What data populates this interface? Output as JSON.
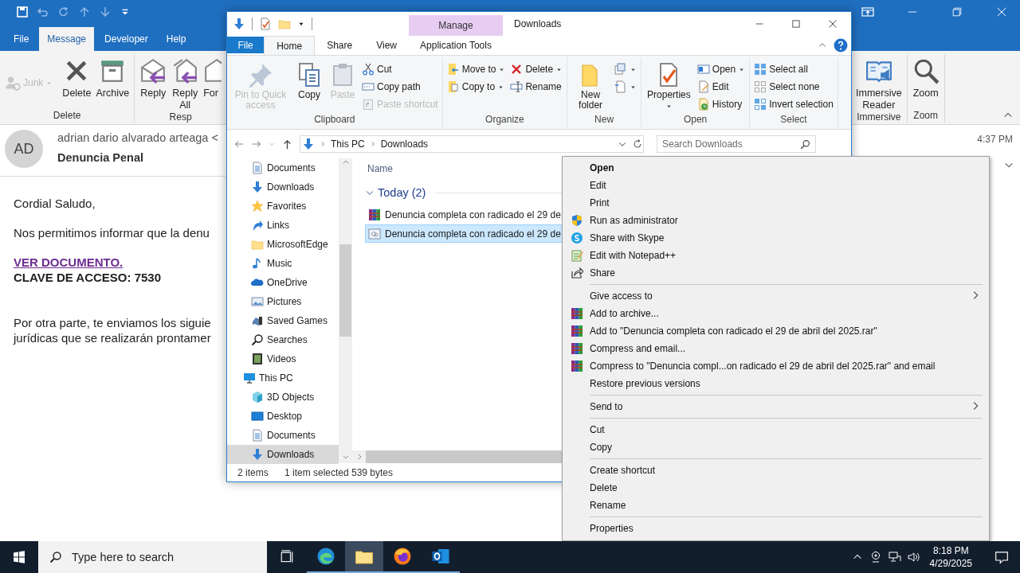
{
  "outlook": {
    "tabs": [
      {
        "label": "File",
        "selected": false
      },
      {
        "label": "Message",
        "selected": true
      },
      {
        "label": "Developer",
        "selected": false
      },
      {
        "label": "Help",
        "selected": false
      }
    ],
    "ribbon_left": [
      {
        "label": "Delete",
        "small": [
          {
            "kind": "junk",
            "label": "Junk",
            "disabled": true
          }
        ],
        "large": [
          {
            "kind": "delete-x",
            "label": "Delete"
          },
          {
            "kind": "archive-box",
            "label": "Archive"
          }
        ]
      },
      {
        "label": "Resp",
        "large": [
          {
            "kind": "reply",
            "label": "Reply"
          },
          {
            "kind": "reply-all",
            "label": "Reply All"
          },
          {
            "kind": "forward",
            "label": "For"
          }
        ]
      }
    ],
    "ribbon_right": [
      {
        "label": "Immersive",
        "large": [
          {
            "kind": "reader",
            "label": "Immersive Reader"
          }
        ]
      },
      {
        "label": "Zoom",
        "large": [
          {
            "kind": "zoom",
            "label": "Zoom"
          }
        ]
      }
    ],
    "message": {
      "avatar": "AD",
      "sender": "adrian dario alvarado arteaga <",
      "subject": "Denuncia Penal",
      "time": "4:37 PM",
      "paragraphs": [
        [
          {
            "kind": "text",
            "text": "Cordial Saludo,"
          }
        ],
        [
          {
            "kind": "text",
            "text": "Nos permitimos informar que la denu"
          }
        ],
        [
          {
            "kind": "link",
            "text": "VER DOCUMENTO."
          },
          {
            "kind": "strong",
            "text": "CLAVE DE ACCESO: 7530"
          }
        ],
        [
          {
            "kind": "text",
            "text": "Por otra parte, te enviamos los siguie"
          },
          {
            "kind": "text",
            "text": "jurídicas que se realizarán prontamer"
          }
        ]
      ]
    }
  },
  "explorer": {
    "context_tab": "Manage",
    "title": "Downloads",
    "tabs": [
      {
        "label": "File",
        "kind": "file",
        "selected": false
      },
      {
        "label": "Home",
        "kind": "tab",
        "selected": true
      },
      {
        "label": "Share",
        "kind": "tab",
        "selected": false
      },
      {
        "label": "View",
        "kind": "tab",
        "selected": false
      },
      {
        "label": "Application Tools",
        "kind": "context",
        "selected": false
      }
    ],
    "ribbon": [
      {
        "label": "Clipboard",
        "large": [
          {
            "kind": "pin",
            "label": "Pin to Quick access",
            "disabled": true
          },
          {
            "kind": "copy",
            "label": "Copy",
            "disabled": false
          },
          {
            "kind": "paste",
            "label": "Paste",
            "disabled": true
          }
        ],
        "columns": [
          [
            {
              "kind": "cut",
              "label": "Cut",
              "disabled": false
            },
            {
              "kind": "copy-path",
              "label": "Copy path",
              "disabled": false
            },
            {
              "kind": "paste-shortcut",
              "label": "Paste shortcut",
              "disabled": true
            }
          ]
        ]
      },
      {
        "label": "Organize",
        "columns": [
          [
            {
              "kind": "move-to",
              "label": "Move to",
              "dropdown": true
            },
            {
              "kind": "copy-to",
              "label": "Copy to",
              "dropdown": true
            }
          ],
          [
            {
              "kind": "delete-red",
              "label": "Delete",
              "dropdown": true
            },
            {
              "kind": "rename",
              "label": "Rename",
              "dropdown": false
            }
          ]
        ]
      },
      {
        "label": "New",
        "large": [
          {
            "kind": "new-folder",
            "label": "New folder"
          }
        ],
        "columns": [
          [
            {
              "kind": "new-item",
              "dropdown": true
            },
            {
              "kind": "easy-access",
              "dropdown": true
            }
          ]
        ]
      },
      {
        "label": "Open",
        "large": [
          {
            "kind": "props",
            "label": "Properties",
            "dropdown": true
          }
        ],
        "columns": [
          [
            {
              "kind": "open",
              "label": "Open",
              "dropdown": true
            },
            {
              "kind": "edit",
              "label": "Edit",
              "dropdown": false
            },
            {
              "kind": "history",
              "label": "History",
              "dropdown": false
            }
          ]
        ]
      },
      {
        "label": "Select",
        "columns": [
          [
            {
              "kind": "select-all",
              "label": "Select all"
            },
            {
              "kind": "select-none",
              "label": "Select none"
            },
            {
              "kind": "invert",
              "label": "Invert selection"
            }
          ]
        ]
      }
    ],
    "address": {
      "path": [
        "This PC",
        "Downloads"
      ],
      "search_placeholder": "Search Downloads"
    },
    "nav_tree": [
      {
        "children": [
          {
            "label": "Documents",
            "kind": "document",
            "selected": false
          },
          {
            "label": "Downloads",
            "kind": "download",
            "selected": false
          },
          {
            "label": "Favorites",
            "kind": "star",
            "selected": false
          },
          {
            "label": "Links",
            "kind": "link",
            "selected": false
          },
          {
            "label": "MicrosoftEdge",
            "kind": "folder-light",
            "selected": false
          },
          {
            "label": "Music",
            "kind": "music",
            "selected": false
          },
          {
            "label": "OneDrive",
            "kind": "cloud",
            "selected": false
          },
          {
            "label": "Pictures",
            "kind": "picture",
            "selected": false
          },
          {
            "label": "Saved Games",
            "kind": "games",
            "selected": false
          },
          {
            "label": "Searches",
            "kind": "searches",
            "selected": false
          },
          {
            "label": "Videos",
            "kind": "video",
            "selected": false
          }
        ]
      },
      {
        "label": "This PC",
        "kind": "pc",
        "selected": false,
        "children": [
          {
            "label": "3D Objects",
            "kind": "cube",
            "selected": false
          },
          {
            "label": "Desktop",
            "kind": "desktop",
            "selected": false
          },
          {
            "label": "Documents",
            "kind": "document",
            "selected": false
          },
          {
            "label": "Downloads",
            "kind": "download",
            "selected": true
          }
        ]
      }
    ],
    "column_header": "Name",
    "group": {
      "label": "Today (2)",
      "expanded": true
    },
    "files": [
      {
        "name": "Denuncia completa con radicado el 29 de",
        "kind": "archive",
        "selected": false
      },
      {
        "name": "Denuncia completa con radicado el 29 de",
        "kind": "shortcut",
        "selected": true
      }
    ],
    "status": [
      "2 items",
      "1 item selected",
      "539 bytes"
    ]
  },
  "context_menu": [
    {
      "kind": "plain",
      "label": "Open",
      "bold": true
    },
    {
      "kind": "plain",
      "label": "Edit",
      "bold": false
    },
    {
      "kind": "plain",
      "label": "Print",
      "bold": false
    },
    {
      "kind": "shield",
      "label": "Run as administrator",
      "bold": false
    },
    {
      "kind": "skype",
      "label": "Share with Skype",
      "bold": false
    },
    {
      "kind": "notepad",
      "label": "Edit with Notepad++",
      "bold": false
    },
    {
      "kind": "share",
      "label": "Share",
      "bold": false
    },
    {
      "kind": "separator"
    },
    {
      "kind": "plain",
      "label": "Give access to",
      "submenu": true
    },
    {
      "kind": "archive",
      "label": "Add to archive..."
    },
    {
      "kind": "archive",
      "label": "Add to \"Denuncia completa con radicado el 29 de abril del 2025.rar\""
    },
    {
      "kind": "archive",
      "label": "Compress and email..."
    },
    {
      "kind": "archive",
      "label": "Compress to \"Denuncia compl...on radicado el 29 de abril del 2025.rar\" and email"
    },
    {
      "kind": "plain",
      "label": "Restore previous versions"
    },
    {
      "kind": "separator"
    },
    {
      "kind": "plain",
      "label": "Send to",
      "submenu": true
    },
    {
      "kind": "separator"
    },
    {
      "kind": "plain",
      "label": "Cut"
    },
    {
      "kind": "plain",
      "label": "Copy"
    },
    {
      "kind": "separator"
    },
    {
      "kind": "plain",
      "label": "Create shortcut"
    },
    {
      "kind": "plain",
      "label": "Delete"
    },
    {
      "kind": "plain",
      "label": "Rename"
    },
    {
      "kind": "separator"
    },
    {
      "kind": "plain",
      "label": "Properties"
    }
  ],
  "taskbar": {
    "search_placeholder": "Type here to search",
    "apps": [
      {
        "kind": "edge",
        "running": true,
        "selected": false
      },
      {
        "kind": "folder",
        "running": true,
        "selected": true
      },
      {
        "kind": "firefox",
        "running": true,
        "selected": false
      },
      {
        "kind": "outlook",
        "running": true,
        "selected": false
      }
    ],
    "time": "8:18 PM",
    "date": "4/29/2025"
  }
}
